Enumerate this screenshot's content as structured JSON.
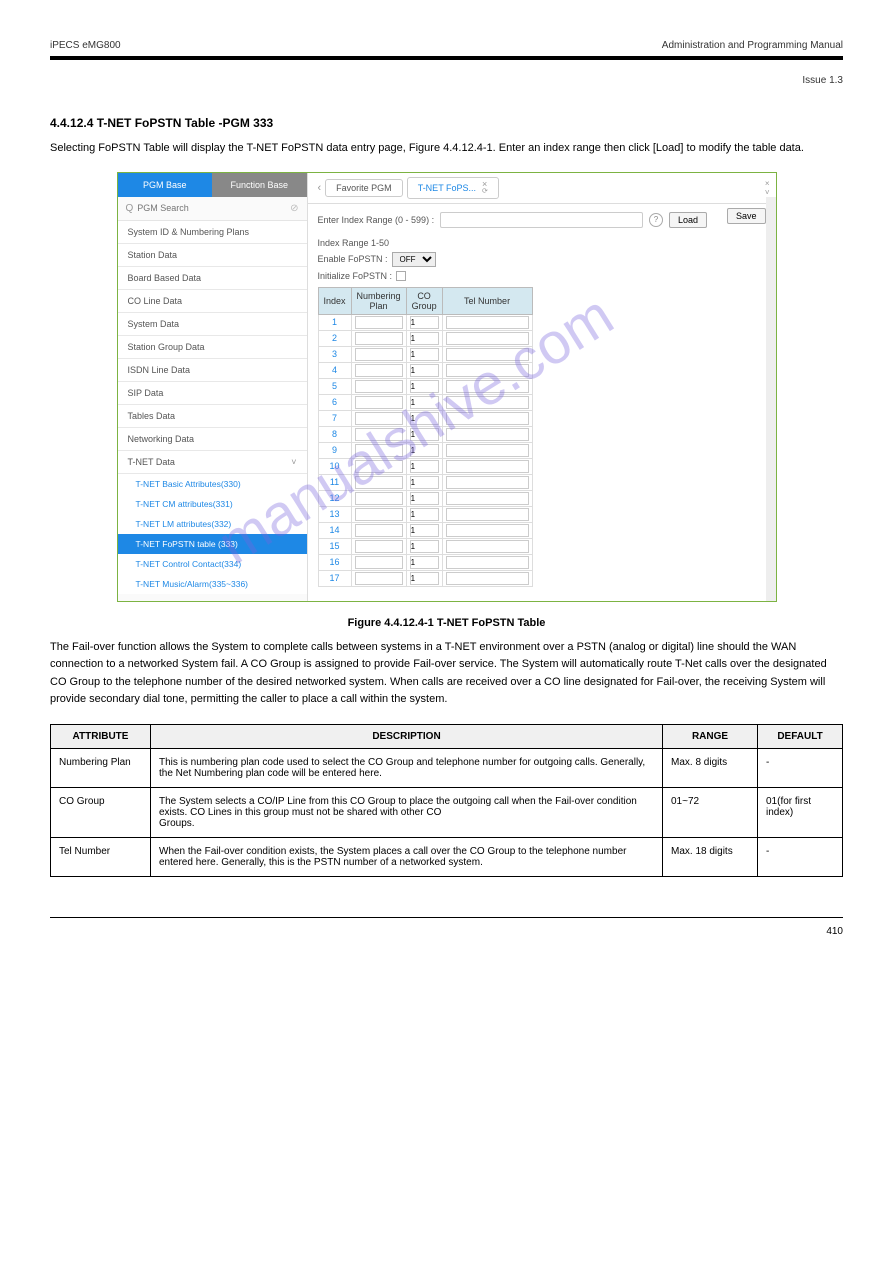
{
  "header": {
    "left": "iPECS eMG800",
    "right": "Administration and Programming Manual",
    "issue": "Issue 1.3"
  },
  "section": {
    "number": "4.4.12.4",
    "title": "T-NET FoPSTN Table -PGM 333"
  },
  "intro": "Selecting FoPSTN Table will display the T-NET FoPSTN data entry page, Figure 4.4.12.4-1. Enter an index range then click [Load] to modify the table data.",
  "sidebar": {
    "pgm_tab": "PGM Base",
    "function_tab": "Function Base",
    "search_placeholder": "PGM Search",
    "items": [
      "System ID & Numbering Plans",
      "Station Data",
      "Board Based Data",
      "CO Line Data",
      "System Data",
      "Station Group Data",
      "ISDN Line Data",
      "SIP Data",
      "Tables Data",
      "Networking Data"
    ],
    "tnet_label": "T-NET Data",
    "tnet_items": [
      "T-NET Basic Attributes(330)",
      "T-NET CM attributes(331)",
      "T-NET LM attributes(332)",
      "T-NET FoPSTN table (333)",
      "T-NET Control Contact(334)",
      "T-NET Music/Alarm(335~336)"
    ]
  },
  "main": {
    "fav_tab": "Favorite PGM",
    "active_tab": "T-NET FoPS...",
    "enter_index": "Enter Index Range (0 - 599) :",
    "load_btn": "Load",
    "save_btn": "Save",
    "index_range": "Index Range 1-50",
    "enable_fopstn": "Enable FoPSTN :",
    "off_value": "OFF",
    "init_fopstn": "Initialize FoPSTN :",
    "headers": {
      "index": "Index",
      "numbering": "Numbering Plan",
      "cogroup": "CO Group",
      "tel": "Tel Number"
    },
    "row_count": 17,
    "co_default": "1"
  },
  "figure_caption": "Figure 4.4.12.4-1 T-NET FoPSTN Table",
  "description": "The Fail-over function allows the System to complete calls between systems in a T-NET environment over a PSTN (analog or digital) line should the WAN connection to a networked System fail. A CO Group is assigned to provide Fail-over service. The System will automatically route T-Net calls over the designated CO Group to the telephone number of the desired networked system. When calls are received over a CO line designated for Fail-over, the receiving System will provide secondary dial tone, permitting the caller to place a call within the system.",
  "table": {
    "headers": {
      "attribute": "ATTRIBUTE",
      "description": "DESCRIPTION",
      "range": "RANGE",
      "default": "DEFAULT"
    },
    "rows": [
      {
        "attribute": "Numbering Plan",
        "description": "This is numbering plan code used to select the CO Group and telephone number for outgoing calls. Generally, the Net Numbering plan code will be entered here.",
        "range": "Max. 8 digits",
        "default": "-"
      },
      {
        "attribute": "CO Group",
        "description": "The System selects a CO/IP Line from this CO Group to place the outgoing call when the Fail-over condition exists. CO Lines in this group must not be shared with other CO\nGroups.",
        "range": "01~72",
        "default": "01(for first index)"
      },
      {
        "attribute": "Tel Number",
        "description": "When the Fail-over condition exists, the System places a call over the CO Group to the telephone number entered here. Generally, this is the PSTN number of a networked system.",
        "range": "Max. 18 digits",
        "default": "-"
      }
    ]
  },
  "footer": {
    "page": "410"
  },
  "watermark": "manualshive.com"
}
